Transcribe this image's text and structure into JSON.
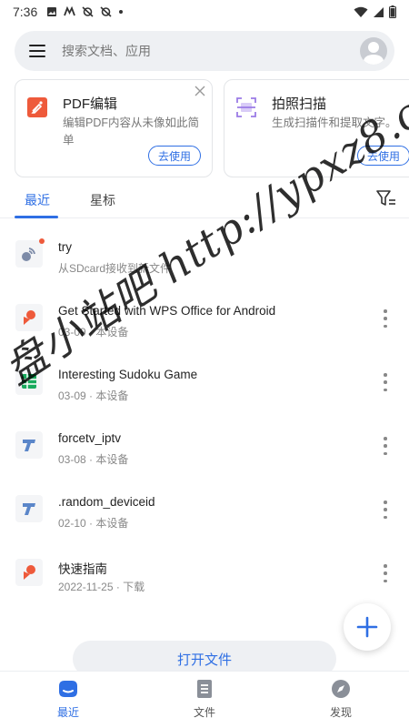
{
  "status_bar": {
    "time": "7:36"
  },
  "search": {
    "placeholder": "搜索文档、应用"
  },
  "cards": [
    {
      "title": "PDF编辑",
      "description": "编辑PDF内容从未像如此简单",
      "button_label": "去使用",
      "icon": "pdf-edit-icon",
      "icon_color": "#ee5a3b"
    },
    {
      "title": "拍照扫描",
      "description": "生成扫描件和提取文字。",
      "button_label": "去使用",
      "icon": "scan-icon",
      "icon_color": "#9b7be6"
    }
  ],
  "tabs": [
    {
      "label": "最近",
      "active": true
    },
    {
      "label": "星标",
      "active": false
    }
  ],
  "files": [
    {
      "name": "try",
      "meta": "从SDcard接收到新文件",
      "icon": "transfer-icon",
      "color": "#7d8ba8",
      "has_new_badge": true
    },
    {
      "name": "Get Started with WPS Office for Android",
      "meta": "03-09 · 本设备",
      "icon": "pdf-file-icon",
      "color": "#ee5a3b"
    },
    {
      "name": "Interesting Sudoku Game",
      "meta": "03-09 · 本设备",
      "icon": "spreadsheet-file-icon",
      "color": "#1aab5e"
    },
    {
      "name": "forcetv_iptv",
      "meta": "03-08 · 本设备",
      "icon": "text-file-icon",
      "color": "#5b86c9"
    },
    {
      "name": ".random_deviceid",
      "meta": "02-10 · 本设备",
      "icon": "text-file-icon",
      "color": "#5b86c9"
    },
    {
      "name": "快速指南",
      "meta": "2022-11-25 · 下载",
      "icon": "pdf-file-icon",
      "color": "#ee5a3b"
    }
  ],
  "open_file_button": "打开文件",
  "bottom_nav": [
    {
      "label": "最近",
      "icon": "recent-icon",
      "active": true
    },
    {
      "label": "文件",
      "icon": "document-icon",
      "active": false
    },
    {
      "label": "发现",
      "icon": "compass-icon",
      "active": false
    }
  ],
  "watermark": "盘小站吧 http://ypxz8.c",
  "colors": {
    "accent": "#2f6fe4"
  }
}
